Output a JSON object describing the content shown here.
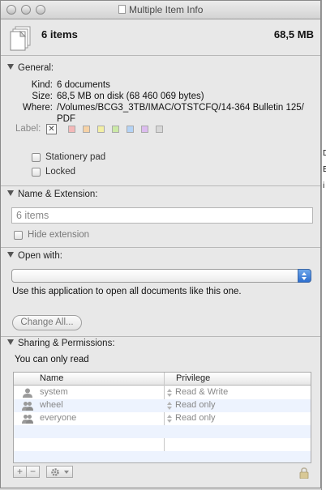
{
  "window": {
    "title": "Multiple Item Info"
  },
  "header": {
    "title": "6 items",
    "size": "68,5 MB"
  },
  "general": {
    "section_label": "General:",
    "kind_label": "Kind:",
    "kind_value": "6 documents",
    "size_label": "Size:",
    "size_value": "68,5 MB on disk (68 460 069 bytes)",
    "where_label": "Where:",
    "where_value_line1": "/Volumes/BCG3_3TB/IMAC/OTSTCFQ/14-364 Bulletin 125/",
    "where_value_line2": "PDF",
    "label_label": "Label:",
    "label_colors": [
      "#f4b8b8",
      "#f6d2a6",
      "#f3efa4",
      "#cbe9a6",
      "#b4d3f6",
      "#dcbcef",
      "#d8d8d8"
    ],
    "stationery_label": "Stationery pad",
    "locked_label": "Locked"
  },
  "name_extension": {
    "section_label": "Name & Extension:",
    "field_value": "6 items",
    "hide_extension_label": "Hide extension"
  },
  "open_with": {
    "section_label": "Open with:",
    "selected_app": "",
    "hint": "Use this application to open all documents like this one.",
    "change_all_label": "Change All..."
  },
  "sharing": {
    "section_label": "Sharing & Permissions:",
    "status": "You can only read",
    "columns": [
      "Name",
      "Privilege"
    ],
    "rows": [
      {
        "name": "system",
        "privilege": "Read & Write"
      },
      {
        "name": "wheel",
        "privilege": "Read only"
      },
      {
        "name": "everyone",
        "privilege": "Read only"
      }
    ],
    "add_symbol": "+",
    "remove_symbol": "−"
  },
  "background_window_fragments": [
    "D",
    "B",
    "i"
  ],
  "icons": [
    "document-stack-icon",
    "disclosure-triangle-icon",
    "user-icon",
    "group-icon",
    "gear-icon",
    "lock-icon",
    "popup-arrows-icon"
  ]
}
